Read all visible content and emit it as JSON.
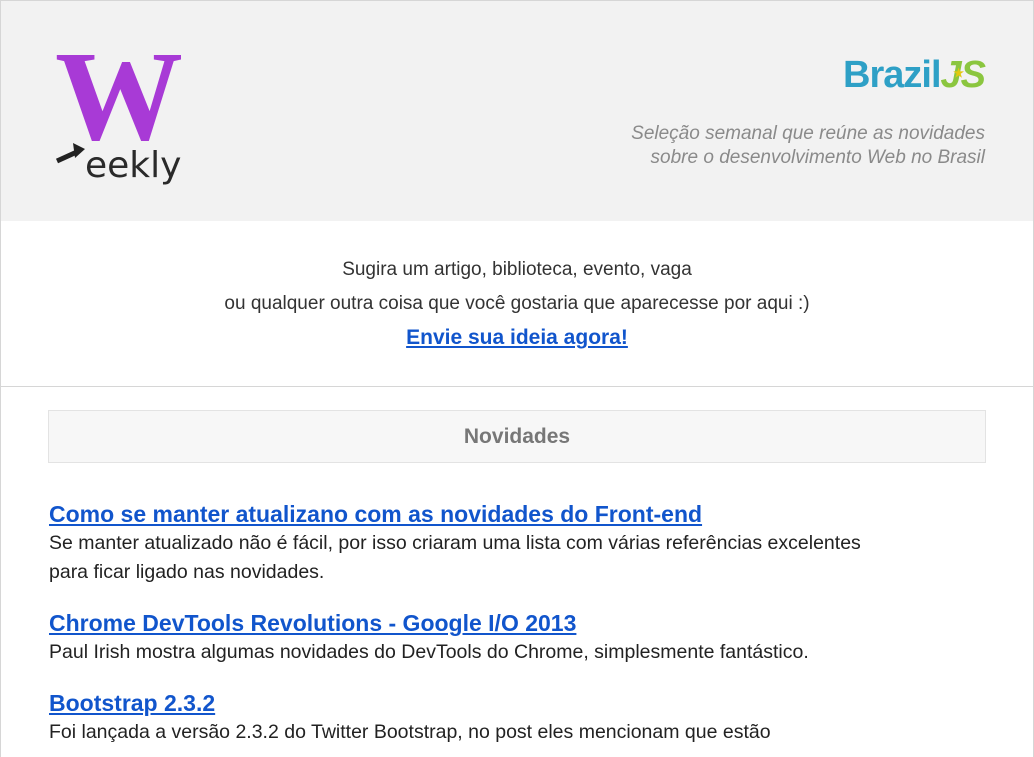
{
  "header": {
    "logo_letter": "W",
    "logo_word": "eekly",
    "brand_left": "Brazil",
    "brand_right": "JS",
    "tagline_line1": "Seleção semanal que reúne as novidades",
    "tagline_line2": "sobre o desenvolvimento Web no Brasil",
    "colors": {
      "logo_purple": "#a83ad6",
      "brand_blue": "#2ea0c6",
      "brand_green": "#8bc63f"
    }
  },
  "suggest": {
    "line1": "Sugira um artigo, biblioteca, evento, vaga",
    "line2": "ou qualquer outra coisa que você gostaria que aparecesse por aqui :)",
    "cta": "Envie sua ideia agora!"
  },
  "section": {
    "title": "Novidades"
  },
  "articles": [
    {
      "title": "Como se manter atualizano com as novidades do Front-end",
      "desc_line1": "Se manter atualizado não é fácil, por isso criaram uma lista com várias referências excelentes",
      "desc_line2": "para ficar ligado nas novidades."
    },
    {
      "title": "Chrome DevTools Revolutions - Google I/O 2013",
      "desc_line1": "Paul Irish mostra algumas novidades do DevTools do Chrome, simplesmente fantástico."
    },
    {
      "title": "Bootstrap 2.3.2",
      "desc_line1": "Foi lançada a versão 2.3.2 do Twitter Bootstrap, no post eles mencionam que estão"
    }
  ],
  "colors": {
    "link": "#1155cc",
    "header_bg": "#f2f2f2"
  }
}
